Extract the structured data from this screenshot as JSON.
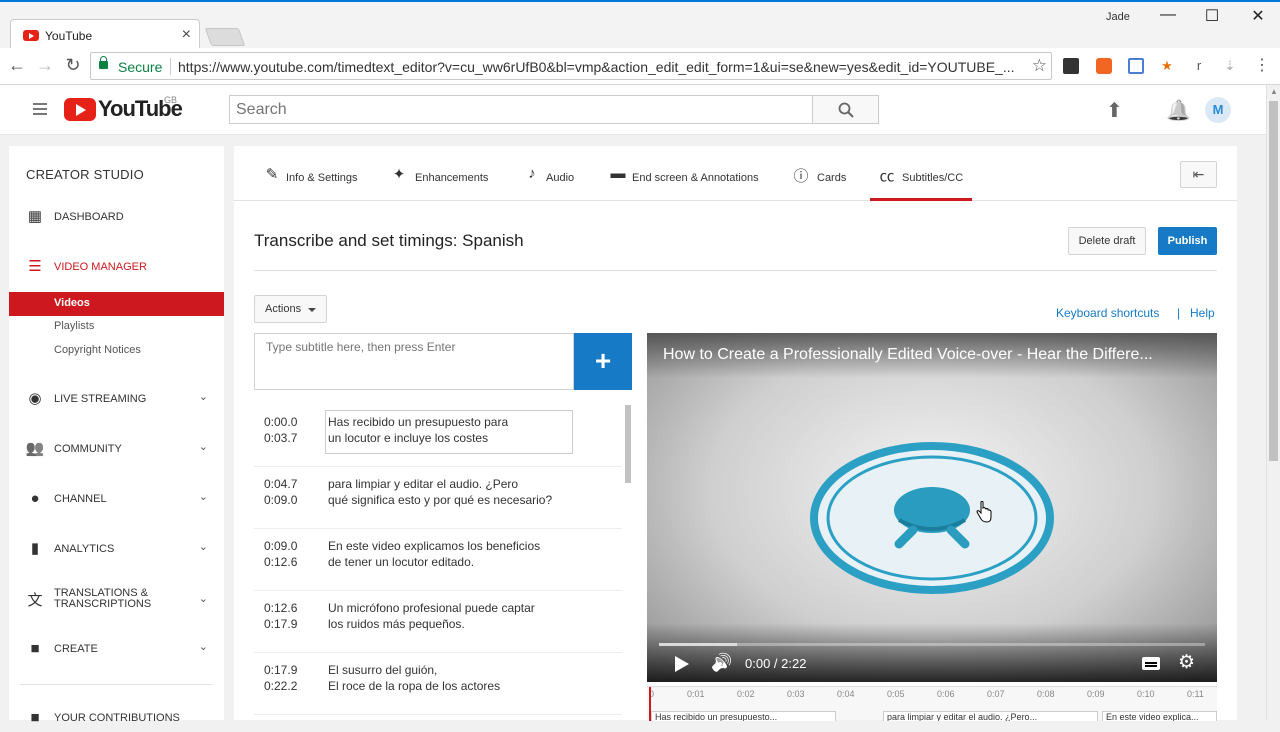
{
  "browser": {
    "tab_title": "YouTube",
    "tab_close": "×",
    "user": "Jade",
    "minimize": "—",
    "maximize": "☐",
    "close": "✕",
    "back": "←",
    "forward": "→",
    "reload": "↻",
    "secure_label": "Secure",
    "url": "https://www.youtube.com/timedtext_editor?v=cu_ww6rUfB0&bl=vmp&action_edit_edit_form=1&ui=se&new=yes&edit_id=YOUTUBE_...",
    "star": "☆",
    "menu": "⋮"
  },
  "header": {
    "logo_text": "YouTube",
    "region": "GB",
    "search_placeholder": "Search",
    "search_icon": "🔍",
    "upload_icon": "⬆",
    "bell_icon": "🔔",
    "avatar": "M"
  },
  "sidebar": {
    "title": "CREATOR STUDIO",
    "items": [
      {
        "label": "DASHBOARD",
        "icon": "▦"
      },
      {
        "label": "VIDEO MANAGER",
        "icon": "☰",
        "color": "#cc181e"
      },
      {
        "label": "LIVE STREAMING",
        "icon": "◉"
      },
      {
        "label": "COMMUNITY",
        "icon": "👥"
      },
      {
        "label": "CHANNEL",
        "icon": "●"
      },
      {
        "label": "ANALYTICS",
        "icon": "▮"
      },
      {
        "label": "TRANSLATIONS &\nTRANSCRIPTIONS",
        "icon": "文"
      },
      {
        "label": "CREATE",
        "icon": "■"
      },
      {
        "label": "YOUR CONTRIBUTIONS",
        "icon": "■"
      }
    ],
    "sub_items": [
      {
        "label": "Videos",
        "active": true
      },
      {
        "label": "Playlists"
      },
      {
        "label": "Copyright Notices"
      }
    ],
    "chevron": "⌄"
  },
  "tabs": [
    {
      "label": "Info & Settings",
      "icon": "✎"
    },
    {
      "label": "Enhancements",
      "icon": "✦"
    },
    {
      "label": "Audio",
      "icon": "♪"
    },
    {
      "label": "End screen & Annotations",
      "icon": "▬"
    },
    {
      "label": "Cards",
      "icon": "ⓘ"
    },
    {
      "label": "Subtitles/CC",
      "icon": "㏄",
      "active": true
    }
  ],
  "back_icon": "⇤",
  "editor": {
    "title": "Transcribe and set timings: Spanish",
    "delete_draft": "Delete draft",
    "publish": "Publish",
    "actions": "Actions",
    "keyboard_shortcuts": "Keyboard shortcuts",
    "separator": "|",
    "help": "Help",
    "subtitle_placeholder": "Type subtitle here, then press Enter",
    "add_icon": "+"
  },
  "captions": [
    {
      "start": "0:00.0",
      "end": "0:03.7",
      "line1": "Has recibido un presupuesto para",
      "line2": "un locutor e incluye los costes"
    },
    {
      "start": "0:04.7",
      "end": "0:09.0",
      "line1": "para limpiar y editar el audio. ¿Pero",
      "line2": "qué significa esto y por qué es necesario?"
    },
    {
      "start": "0:09.0",
      "end": "0:12.6",
      "line1": "En este video explicamos los beneficios",
      "line2": "de tener un locutor editado."
    },
    {
      "start": "0:12.6",
      "end": "0:17.9",
      "line1": "Un micrófono profesional puede captar",
      "line2": "los ruidos más pequeños."
    },
    {
      "start": "0:17.9",
      "end": "0:22.2",
      "line1": "El susurro del guión,",
      "line2": "El roce de la ropa de los actores"
    }
  ],
  "video": {
    "title": "How to Create a Professionally Edited Voice-over - Hear the Differe...",
    "time": "0:00 / 2:22",
    "volume_icon": "🔊",
    "settings_icon": "⚙"
  },
  "timeline": {
    "ticks": [
      "0",
      "0:01",
      "0:02",
      "0:03",
      "0:04",
      "0:05",
      "0:06",
      "0:07",
      "0:08",
      "0:09",
      "0:10",
      "0:11"
    ],
    "captions": [
      "Has recibido un presupuesto...",
      "para limpiar y editar el audio. ¿Pero...",
      "En este video explica..."
    ]
  },
  "colors": {
    "accent": "#167ac6",
    "brand": "#cc181e"
  }
}
